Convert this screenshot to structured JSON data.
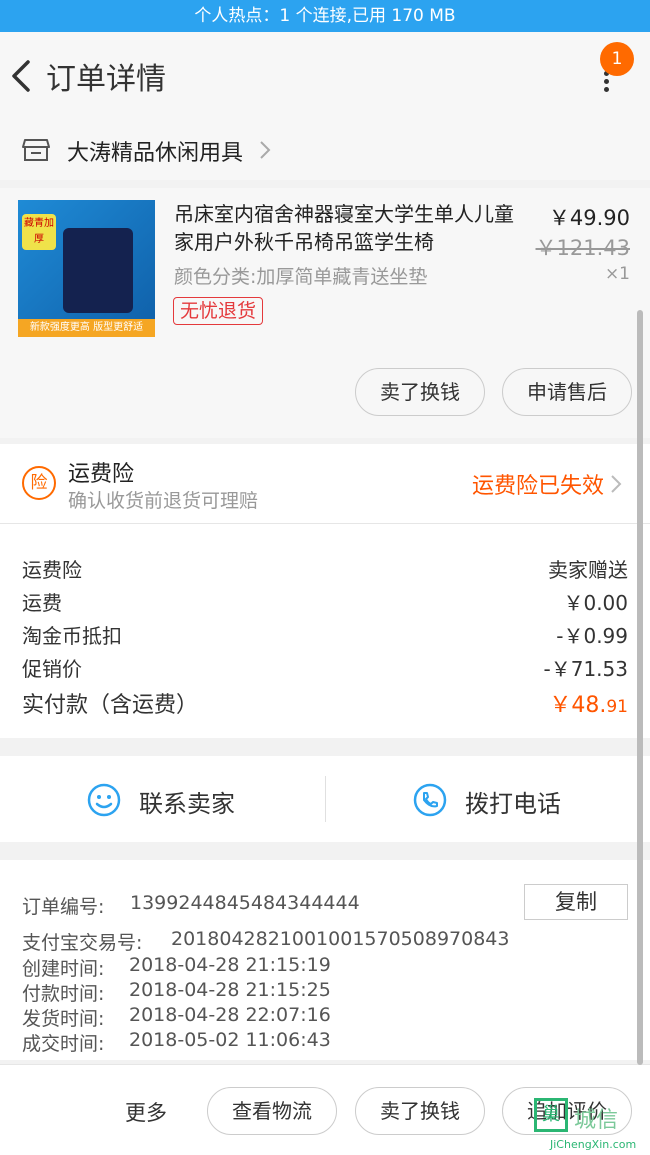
{
  "status_bar": {
    "text": "个人热点：1 个连接,已用 170 MB"
  },
  "header": {
    "title": "订单详情",
    "badge": "1"
  },
  "shop": {
    "name": "大涛精品休闲用具"
  },
  "product": {
    "title": "吊床室内宿舍神器寝室大学生单人儿童家用户外秋千吊椅吊篮学生椅",
    "price": "￥49.90",
    "original_price": "￥121.43",
    "sku": "颜色分类:加厚简单藏青送坐垫",
    "quantity": "×1",
    "tag": "无忧退货",
    "image_tag": "藏青加厚",
    "image_banner": "新款强度更高 版型更舒适",
    "buttons": [
      "卖了换钱",
      "申请售后"
    ]
  },
  "insurance": {
    "icon_text": "险",
    "title": "运费险",
    "subtitle": "确认收货前退货可理赔",
    "status": "运费险已失效"
  },
  "fees": [
    {
      "label": "运费险",
      "value": "卖家赠送"
    },
    {
      "label": "运费",
      "value": "￥0.00"
    },
    {
      "label": "淘金币抵扣",
      "value": "-￥0.99"
    },
    {
      "label": "促销价",
      "value": "-￥71.53"
    }
  ],
  "total": {
    "label": "实付款（含运费）",
    "value_main": "￥48.",
    "value_decimal": "91"
  },
  "contact": {
    "seller": "联系卖家",
    "phone": "拨打电话"
  },
  "order_info": {
    "order_no_label": "订单编号:",
    "order_no": "1399244845484344444",
    "copy_label": "复制",
    "alipay_label": "支付宝交易号:",
    "alipay_no": "2018042821001001570508970843",
    "created_label": "创建时间:",
    "created": "2018-04-28 21:15:19",
    "paid_label": "付款时间:",
    "paid": "2018-04-28 21:15:25",
    "shipped_label": "发货时间:",
    "shipped": "2018-04-28 22:07:16",
    "completed_label": "成交时间:",
    "completed": "2018-05-02 11:06:43"
  },
  "footer": {
    "more": "更多",
    "buttons": [
      "查看物流",
      "卖了换钱",
      "追加评价"
    ]
  },
  "watermark": {
    "box": "巢",
    "name": "城信",
    "url": "JiChengXin.com"
  }
}
